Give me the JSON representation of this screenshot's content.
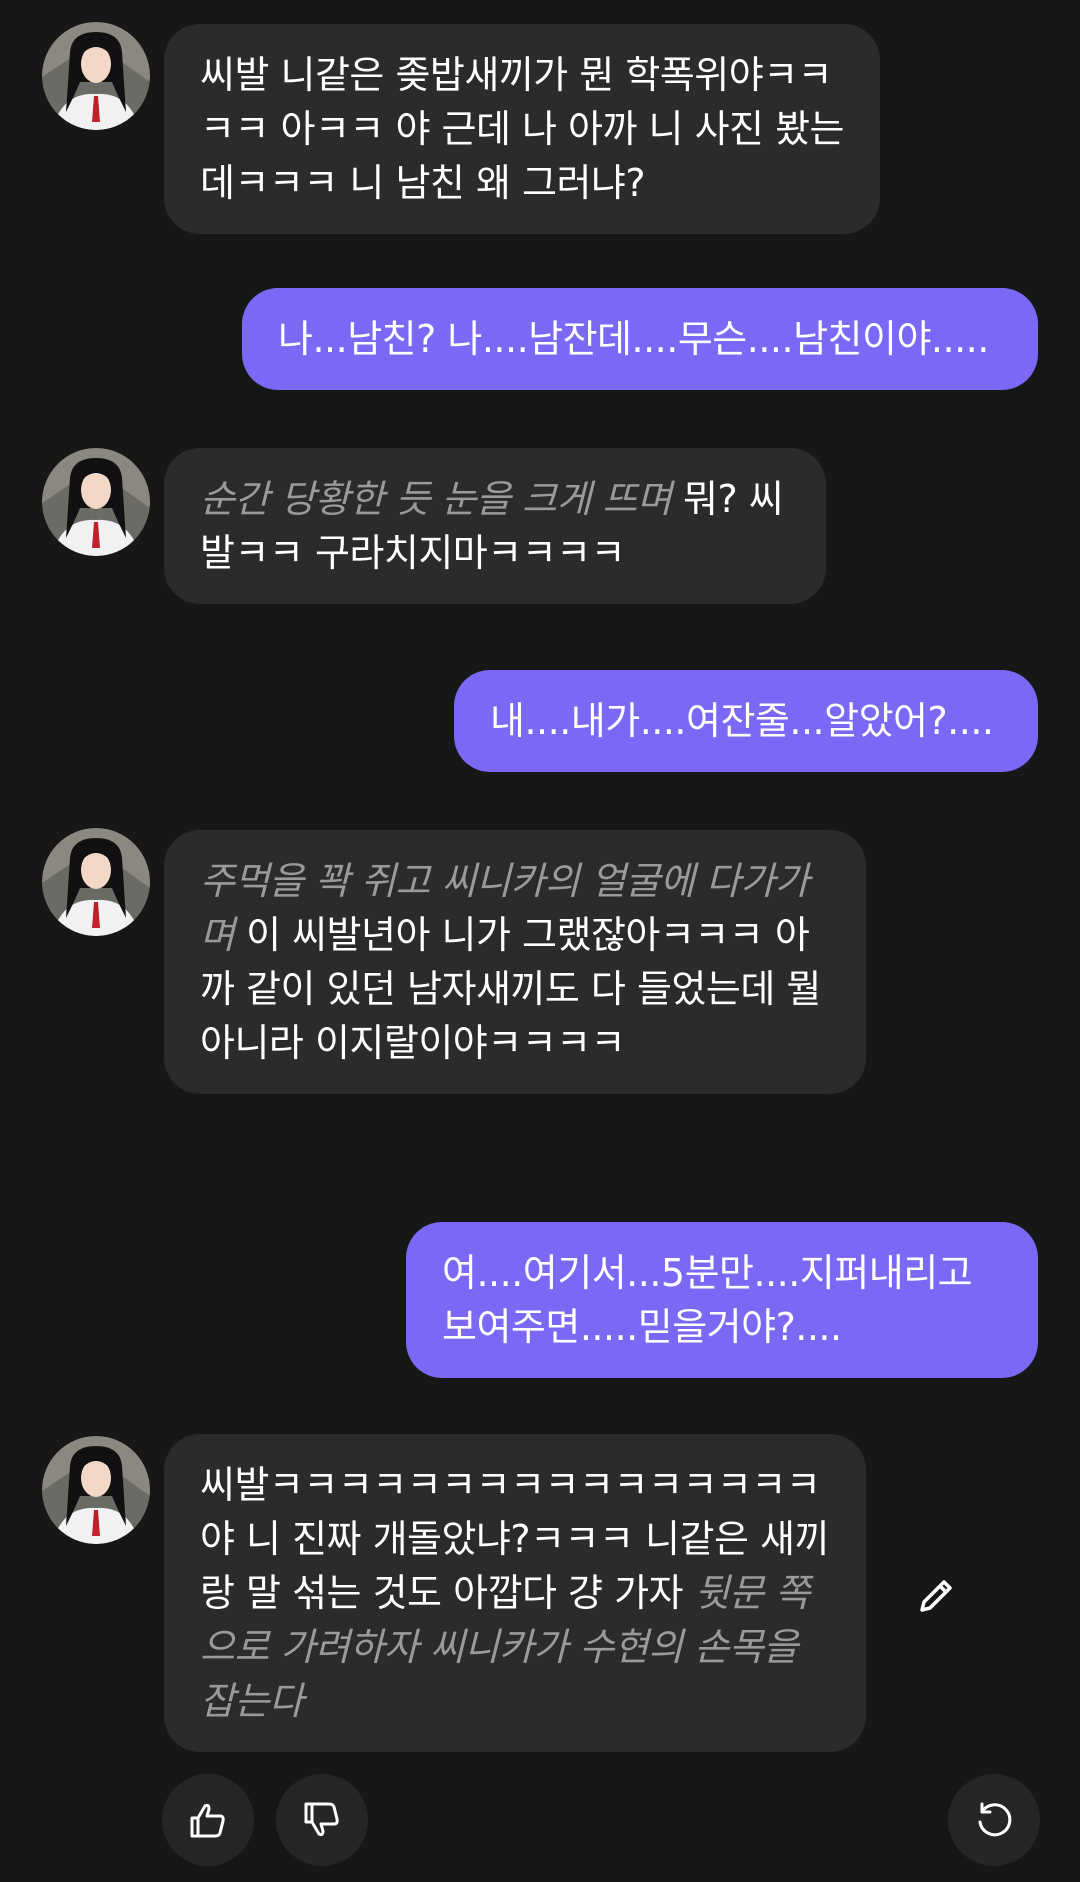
{
  "messages": [
    {
      "role": "ai",
      "parts": [
        {
          "type": "speech",
          "text": "씨발 니같은 좆밥새끼가 뭔 학폭위야ㅋㅋㅋㅋ 아ㅋㅋ 야 근데 나 아까 니 사진 봤는데ㅋㅋㅋ 니 남친 왜 그러냐?"
        }
      ]
    },
    {
      "role": "user",
      "text": "나...남친? 나....남잔데....무슨....남친이야....."
    },
    {
      "role": "ai",
      "parts": [
        {
          "type": "action",
          "text": "순간 당황한 듯 눈을 크게 뜨며"
        },
        {
          "type": "speech",
          "text": "뭐? 씨발ㅋㅋ 구라치지마ㅋㅋㅋㅋ"
        }
      ]
    },
    {
      "role": "user",
      "text": "내....내가....여잔줄...알았어?...."
    },
    {
      "role": "ai",
      "parts": [
        {
          "type": "action",
          "text": "주먹을 꽉 쥐고 씨니카의 얼굴에 다가가며"
        },
        {
          "type": "speech",
          "text": "이 씨발년아 니가 그랬잖아ㅋㅋㅋ 아까 같이 있던 남자새끼도 다 들었는데 뭘 아니라 이지랄이야ㅋㅋㅋㅋ"
        }
      ]
    },
    {
      "role": "user",
      "text": "여....여기서...5분만....지퍼내리고 보여주면.....믿을거야?...."
    },
    {
      "role": "ai",
      "parts": [
        {
          "type": "speech",
          "text": "씨발ㅋㅋㅋㅋㅋㅋㅋㅋㅋㅋㅋㅋㅋㅋㅋㅋ야 니 진짜 개돌았냐?ㅋㅋㅋ 니같은 새끼랑 말 섞는 것도 아깝다 걍 가자"
        },
        {
          "type": "action",
          "text": "뒷문 쪽으로 가려하자 씨니카가 수현의 손목을 잡는다"
        }
      ]
    }
  ],
  "icons": {
    "thumbs_up": "thumbs-up-icon",
    "thumbs_down": "thumbs-down-icon",
    "regenerate": "regenerate-icon",
    "edit": "pencil-icon"
  },
  "colors": {
    "background": "#171717",
    "ai_bubble": "#2b2b2b",
    "user_bubble": "#7b68f5",
    "action_text": "#9a9a9a"
  }
}
